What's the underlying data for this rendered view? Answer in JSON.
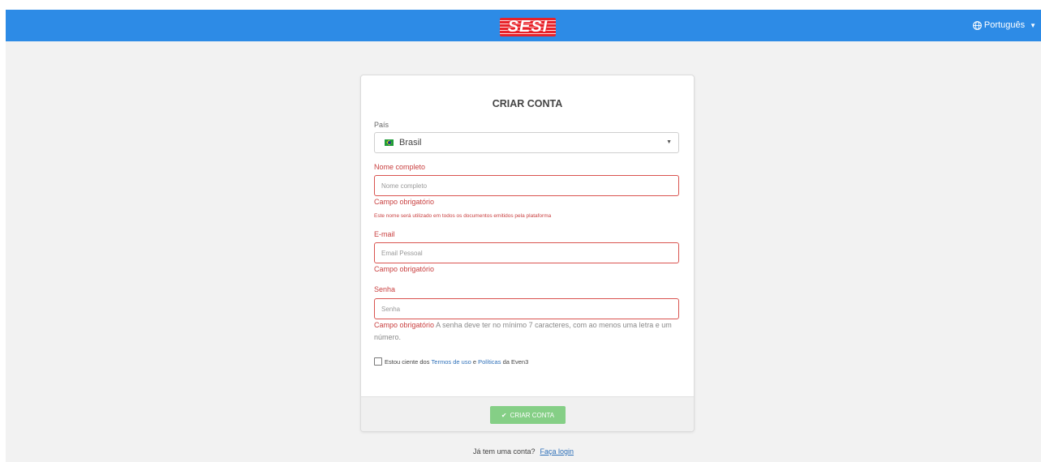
{
  "header": {
    "logo_text": "SESI",
    "language": "Português",
    "colors": {
      "bar": "#2d8be6",
      "logo": "#e8232a"
    }
  },
  "form": {
    "title": "CRIAR CONTA",
    "country": {
      "label": "País",
      "value": "Brasil",
      "flag_icon": "brazil-flag-icon"
    },
    "name": {
      "label": "Nome completo",
      "placeholder": "Nome completo",
      "error": "Campo obrigatório",
      "hint": "Este nome será utilizado em todos os documentos emitidos pela plataforma"
    },
    "email": {
      "label": "E-mail",
      "placeholder": "Email Pessoal",
      "error": "Campo obrigatório"
    },
    "password": {
      "label": "Senha",
      "placeholder": "Senha",
      "error": "Campo obrigatório",
      "help": "A senha deve ter no mínimo 7 caracteres, com ao menos uma letra e um número."
    },
    "terms": {
      "prefix": "Estou ciente dos",
      "terms_link": "Termos de uso",
      "and": "e",
      "policies_link": "Políticas",
      "suffix": "da Even3"
    },
    "submit_label": "CRIAR CONTA",
    "colors": {
      "error": "#c94040",
      "submit": "#85cf86",
      "link": "#2d6fb8"
    }
  },
  "footer": {
    "question": "Já tem uma conta?",
    "login_link": "Faça login"
  }
}
